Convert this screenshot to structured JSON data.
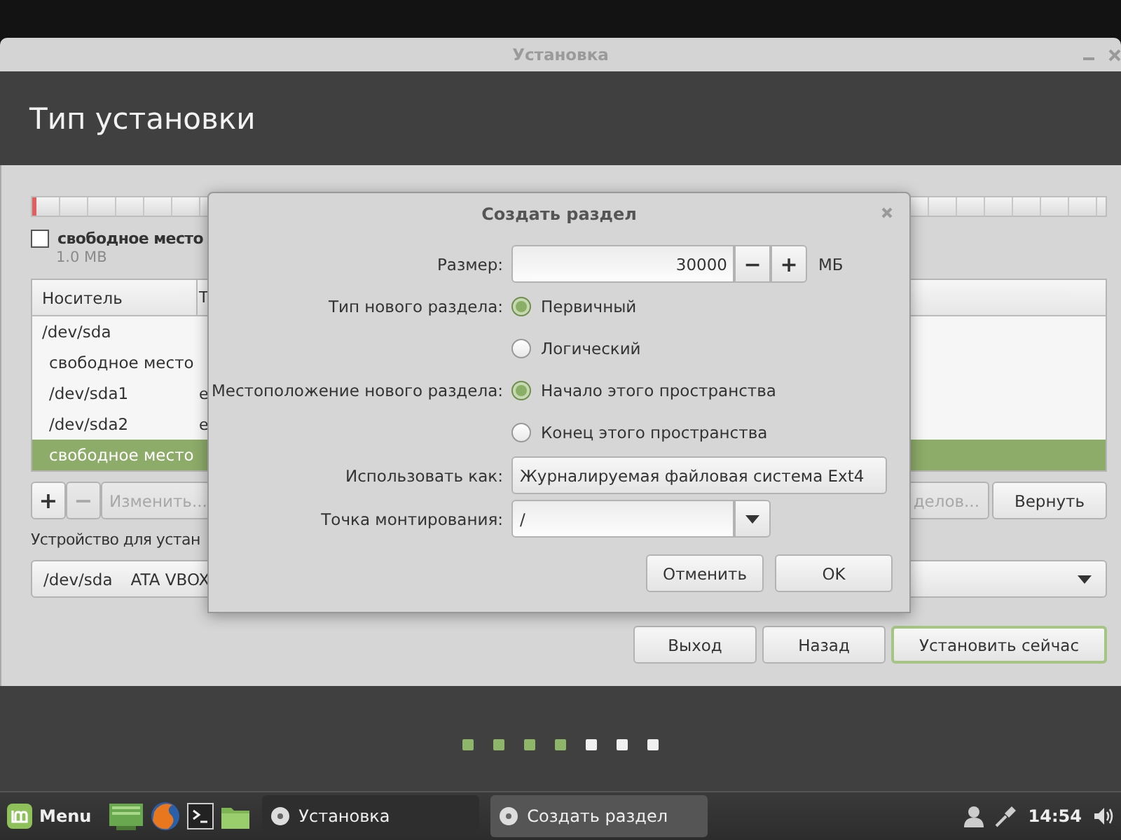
{
  "window": {
    "title": "Установка"
  },
  "header": {
    "title": "Тип установки"
  },
  "free_space": {
    "label": "свободное место",
    "size": "1.0 MB",
    "checked": false
  },
  "table": {
    "columns": [
      "Носитель",
      "Т"
    ],
    "rows": [
      {
        "device": "/dev/sda",
        "selected": false,
        "children": [
          {
            "device": "свободное место",
            "selected": false
          },
          {
            "device": "/dev/sda1",
            "column_2": "e",
            "selected": false
          },
          {
            "device": "/dev/sda2",
            "column_2": "e",
            "selected": false
          },
          {
            "device": "свободное место",
            "selected": true
          }
        ]
      }
    ]
  },
  "partition_buttons": [
    {
      "label": "+",
      "kind": "icon",
      "disabled": false
    },
    {
      "label": "−",
      "kind": "icon",
      "disabled": true
    },
    {
      "label": "Изменить...",
      "kind": "text",
      "disabled": true
    },
    {
      "label": "делов...",
      "kind": "wide",
      "disabled": true
    },
    {
      "label": "Вернуть",
      "kind": "text",
      "disabled": false
    }
  ],
  "device_label": "Устройство для устан",
  "device_select": {
    "device": "/dev/sda",
    "model": "ATA VBOX"
  },
  "nav_buttons": [
    {
      "label": "Выход",
      "default": false
    },
    {
      "label": "Назад",
      "default": false
    },
    {
      "label": "Установить сейчас",
      "default": true
    }
  ],
  "progress_steps": [
    {
      "done": true
    },
    {
      "done": true
    },
    {
      "done": true
    },
    {
      "done": true
    },
    {
      "done": false
    },
    {
      "done": false
    },
    {
      "done": false
    }
  ],
  "dialog": {
    "title": "Создать раздел",
    "size": {
      "label": "Размер:",
      "value": "30000",
      "minus": "−",
      "plus": "+",
      "unit": "МБ"
    },
    "type": {
      "label": "Тип нового раздела:",
      "options": [
        {
          "label": "Первичный",
          "selected": true
        },
        {
          "label": "Логический",
          "selected": false
        }
      ]
    },
    "location": {
      "label": "Местоположение нового раздела:",
      "options": [
        {
          "label": "Начало этого пространства",
          "selected": true
        },
        {
          "label": "Конец этого пространства",
          "selected": false
        }
      ]
    },
    "use_as": {
      "label": "Использовать как:",
      "value": "Журналируемая файловая система Ext4"
    },
    "mount_point": {
      "label": "Точка монтирования:",
      "value": "/"
    },
    "buttons": [
      "Отменить",
      "OK"
    ]
  },
  "taskbar": {
    "menu": "Menu",
    "windows": [
      {
        "title": "Установка",
        "active": false
      },
      {
        "title": "Создать раздел",
        "active": true
      }
    ],
    "clock": "14:54"
  }
}
